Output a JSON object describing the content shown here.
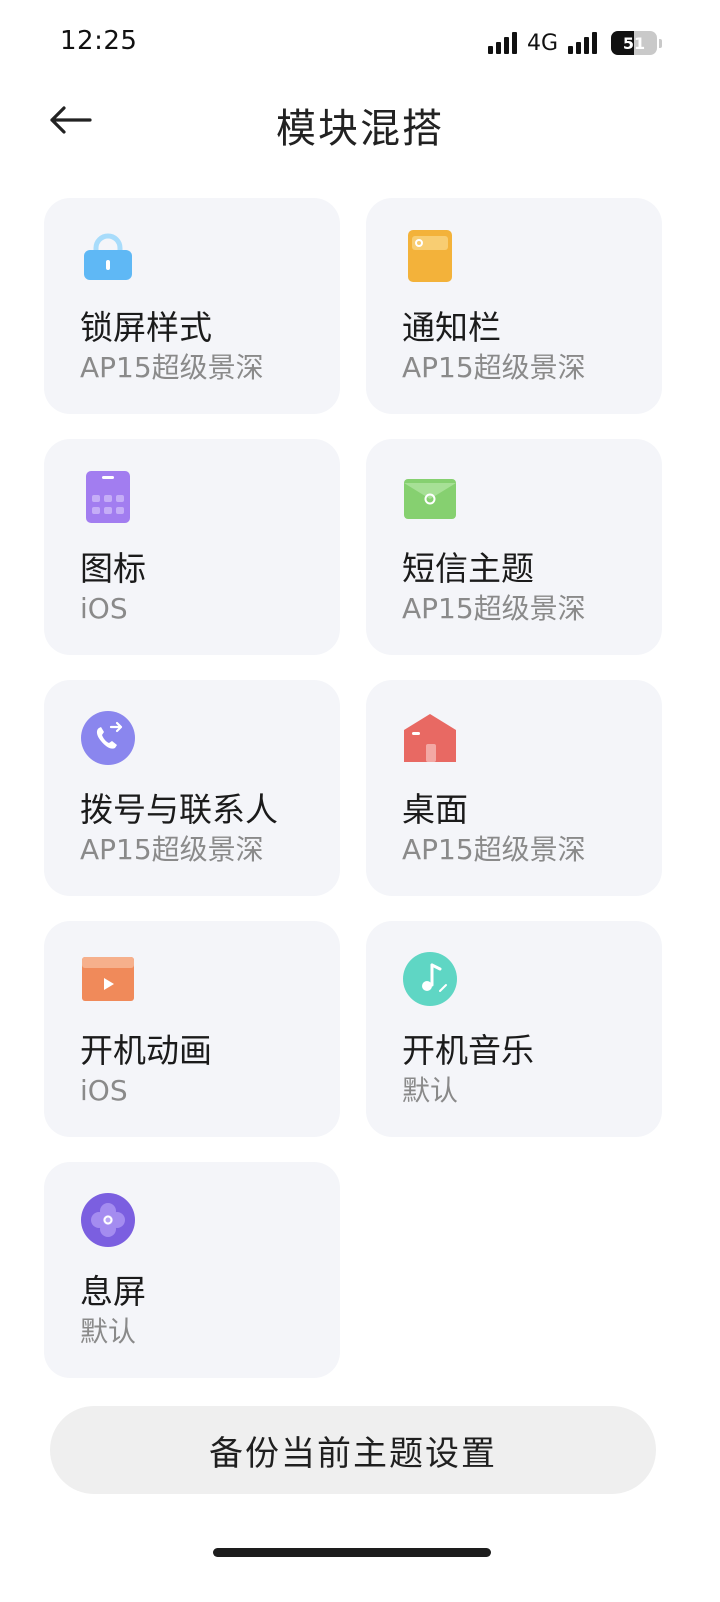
{
  "status_bar": {
    "time": "12:25",
    "network": "4G",
    "battery_level": "51",
    "battery_fraction": 0.51
  },
  "header": {
    "title": "模块混搭",
    "back_icon": "arrow-left-icon"
  },
  "modules": [
    {
      "name": "锁屏样式",
      "value": "AP15超级景深",
      "icon": "lock-icon",
      "color": "#5fb8f5"
    },
    {
      "name": "通知栏",
      "value": "AP15超级景深",
      "icon": "notification-panel-icon",
      "color": "#f3b23a"
    },
    {
      "name": "图标",
      "value": "iOS",
      "icon": "app-grid-icon",
      "color": "#a27df0"
    },
    {
      "name": "短信主题",
      "value": "AP15超级景深",
      "icon": "message-envelope-icon",
      "color": "#86d070"
    },
    {
      "name": "拨号与联系人",
      "value": "AP15超级景深",
      "icon": "phone-icon",
      "color": "#8a86ee"
    },
    {
      "name": "桌面",
      "value": "AP15超级景深",
      "icon": "home-icon",
      "color": "#e86963"
    },
    {
      "name": "开机动画",
      "value": "iOS",
      "icon": "video-play-icon",
      "color": "#f08a5a"
    },
    {
      "name": "开机音乐",
      "value": "默认",
      "icon": "music-note-icon",
      "color": "#5fd6c4"
    },
    {
      "name": "息屏",
      "value": "默认",
      "icon": "aod-flower-icon",
      "color": "#7b5fe0"
    }
  ],
  "backup_button": {
    "label": "备份当前主题设置"
  }
}
